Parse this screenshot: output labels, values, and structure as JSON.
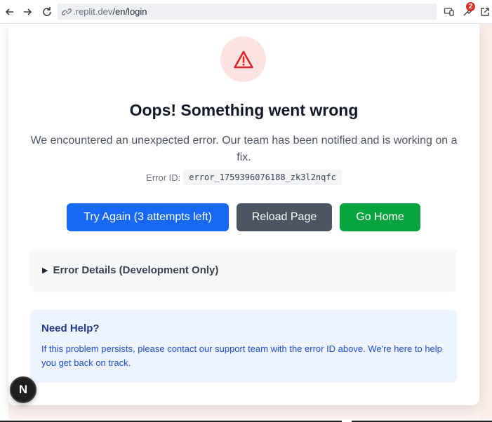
{
  "browser": {
    "url_host": ".replit.dev",
    "url_path": "/en/login",
    "extension_badge_count": "2"
  },
  "error_page": {
    "title": "Oops! Something went wrong",
    "description": "We encountered an unexpected error. Our team has been notified and is working on a fix.",
    "error_id_label": "Error ID:",
    "error_id_value": "error_1759396076188_zk3l2nqfc",
    "buttons": {
      "try_again": "Try Again (3 attempts left)",
      "reload": "Reload Page",
      "home": "Go Home"
    },
    "details_label": "Error Details (Development Only)",
    "help": {
      "title": "Need Help?",
      "text": "If this problem persists, please contact our support team with the error ID above. We're here to help you get back on track."
    }
  },
  "dev_badge": "N",
  "colors": {
    "try_again": "#1769f5",
    "reload": "#4b5563",
    "home": "#07a33f",
    "warning": "#dc2626",
    "help_bg": "#eef4ff"
  }
}
